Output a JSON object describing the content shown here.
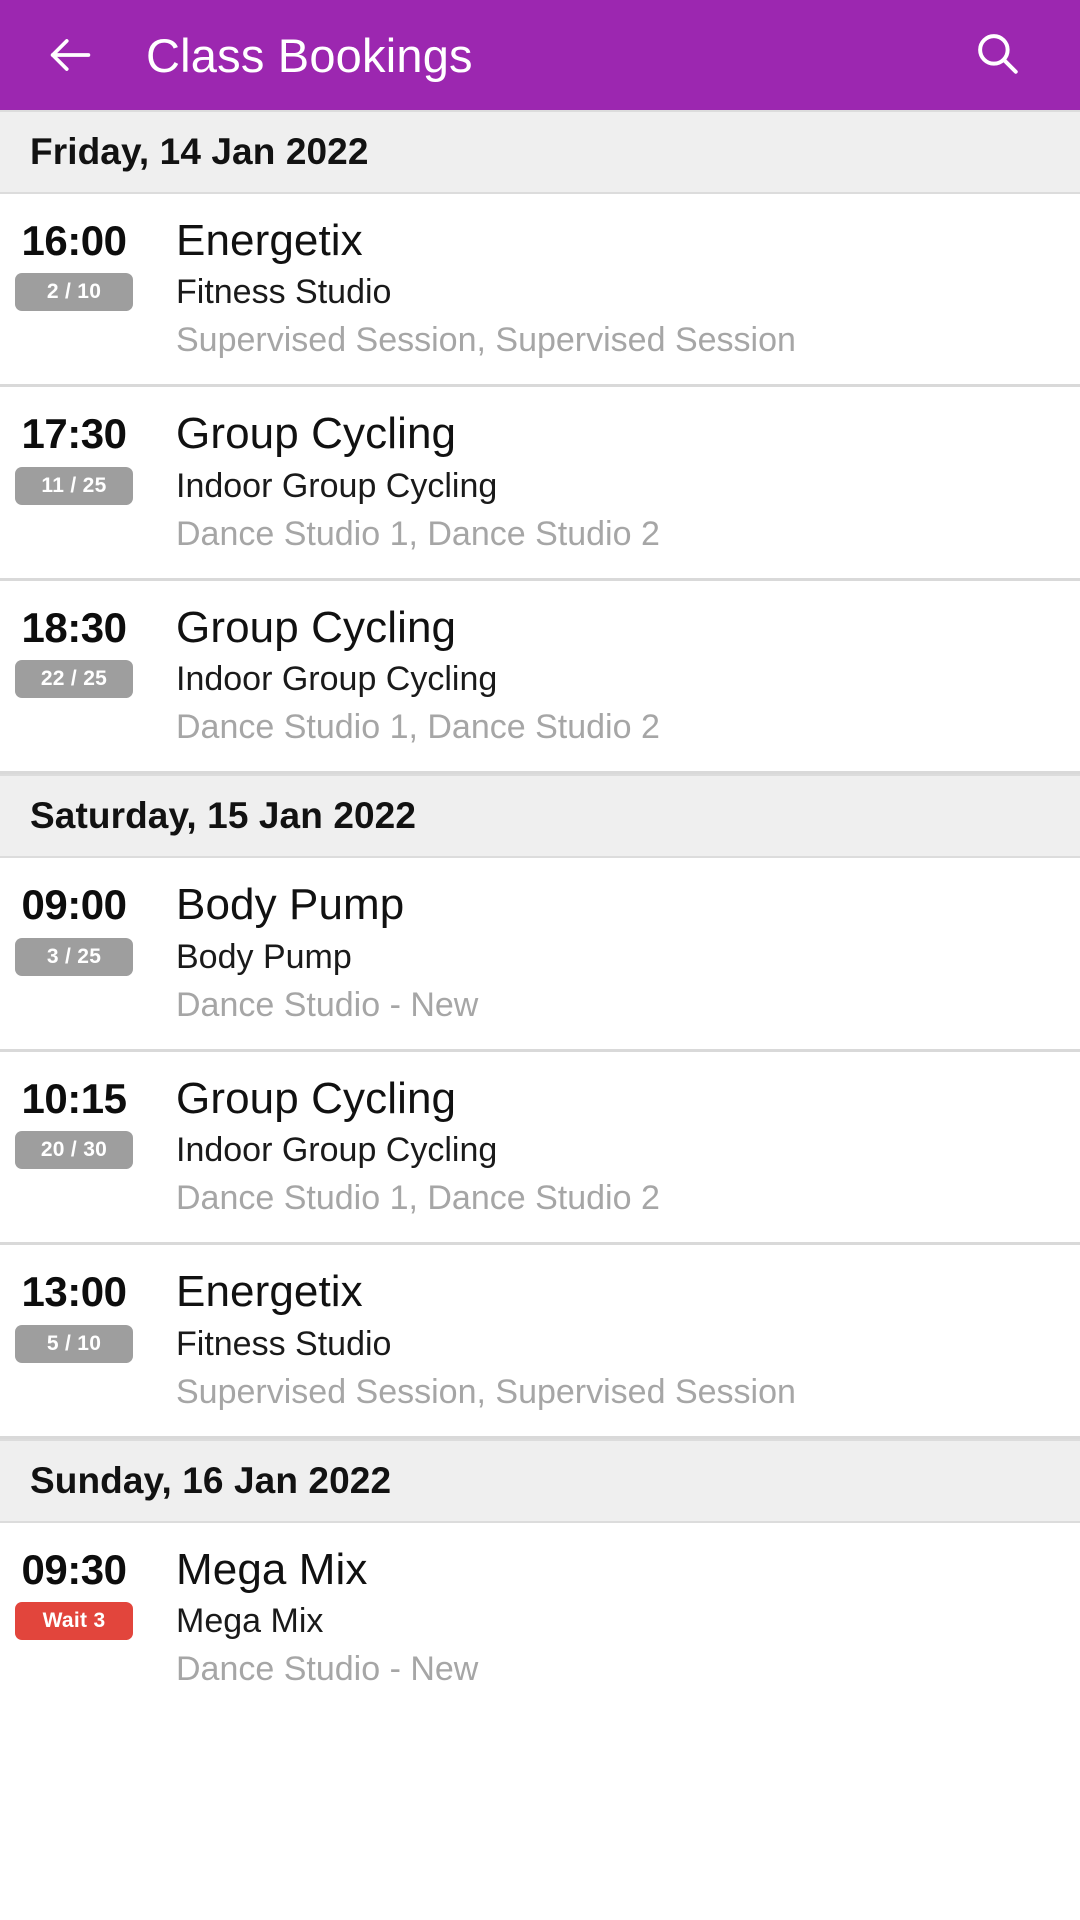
{
  "appbar": {
    "back_icon": "arrow-left-icon",
    "title": "Class Bookings",
    "search_icon": "search-icon",
    "background_color": "#9C27B0",
    "text_color": "#FFFFFF"
  },
  "colors": {
    "accent_purple": "#9C27B0",
    "section_header_bg": "#EFEFEF",
    "badge_gray": "#9E9E9E",
    "badge_red": "#E2453C",
    "muted_text": "#A6A6A6",
    "divider": "#D9D9D9"
  },
  "sections": [
    {
      "date": "Friday, 14 Jan 2022",
      "bookings": [
        {
          "time": "16:00",
          "badge": {
            "label": "2 / 10",
            "type": "capacity",
            "style": "gray"
          },
          "name": "Energetix",
          "subtitle": "Fitness Studio",
          "location": "Supervised Session, Supervised Session"
        },
        {
          "time": "17:30",
          "badge": {
            "label": "11 / 25",
            "type": "capacity",
            "style": "gray"
          },
          "name": "Group Cycling",
          "subtitle": "Indoor Group Cycling",
          "location": "Dance Studio 1, Dance Studio 2"
        },
        {
          "time": "18:30",
          "badge": {
            "label": "22 / 25",
            "type": "capacity",
            "style": "gray"
          },
          "name": "Group Cycling",
          "subtitle": "Indoor Group Cycling",
          "location": "Dance Studio 1, Dance Studio 2"
        }
      ]
    },
    {
      "date": "Saturday, 15 Jan 2022",
      "bookings": [
        {
          "time": "09:00",
          "badge": {
            "label": "3 / 25",
            "type": "capacity",
            "style": "gray"
          },
          "name": "Body Pump",
          "subtitle": "Body Pump",
          "location": "Dance Studio - New"
        },
        {
          "time": "10:15",
          "badge": {
            "label": "20 / 30",
            "type": "capacity",
            "style": "gray"
          },
          "name": "Group Cycling",
          "subtitle": "Indoor Group Cycling",
          "location": "Dance Studio 1, Dance Studio 2"
        },
        {
          "time": "13:00",
          "badge": {
            "label": "5 / 10",
            "type": "capacity",
            "style": "gray"
          },
          "name": "Energetix",
          "subtitle": "Fitness Studio",
          "location": "Supervised Session, Supervised Session"
        }
      ]
    },
    {
      "date": "Sunday, 16 Jan 2022",
      "bookings": [
        {
          "time": "09:30",
          "badge": {
            "label": "Wait 3",
            "type": "waitlist",
            "style": "red"
          },
          "name": "Mega Mix",
          "subtitle": "Mega Mix",
          "location": "Dance Studio - New"
        }
      ]
    }
  ]
}
